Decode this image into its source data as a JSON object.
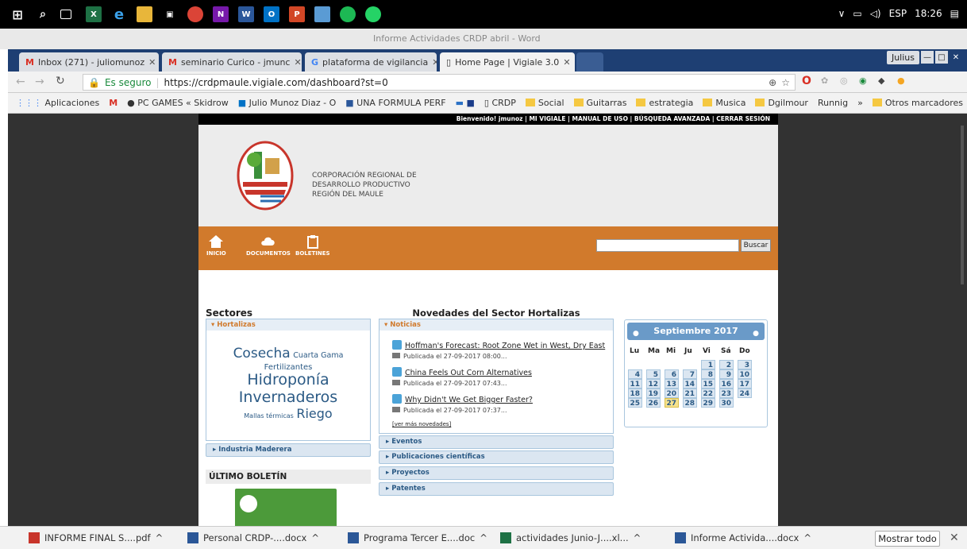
{
  "taskbar": {
    "tray": {
      "lang": "ESP",
      "time": "18:26"
    }
  },
  "desktop": {
    "window_title": "Informe Actividades CRDP abril - Word"
  },
  "chrome": {
    "tabs": [
      {
        "label": "Inbox (271) - juliomunoz"
      },
      {
        "label": "seminario Curico - jmunc"
      },
      {
        "label": "plataforma de vigilancia"
      },
      {
        "label": "Home Page | Vigiale 3.0"
      }
    ],
    "user": "Julius",
    "secure_label": "Es seguro",
    "url": "https://crdpmaule.vigiale.com/dashboard?st=0",
    "bookmarks": [
      "Aplicaciones",
      "PC GAMES « Skidrow",
      "Julio Munoz Diaz - O",
      "UNA FORMULA PERF",
      "CRDP",
      "Social",
      "Guitarras",
      "estrategia",
      "Musica",
      "Dgilmour",
      "Runnig",
      "»",
      "Otros marcadores"
    ]
  },
  "site": {
    "topbar": "Bienvenido! jmunoz  |  MI VIGIALE  |  MANUAL DE USO  |  BÚSQUEDA AVANZADA  |  CERRAR SESIÓN",
    "org": [
      "CORPORACIÓN REGIONAL DE",
      "DESARROLLO PRODUCTIVO",
      "REGIÓN DEL MAULE"
    ],
    "nav": [
      {
        "label": "INICIO"
      },
      {
        "label": "DOCUMENTOS"
      },
      {
        "label": "BOLETINES"
      }
    ],
    "search_button": "Buscar",
    "sectores_title": "Sectores",
    "sector_hortalizas": "Hortalizas",
    "tags": {
      "cosecha": "Cosecha",
      "cuarta": "Cuarta Gama",
      "fert": "Fertilizantes",
      "hidro": "Hidroponía",
      "inver": "Invernaderos",
      "mallas": "Mallas térmicas",
      "riego": "Riego"
    },
    "sector_maderera": "Industria Maderera",
    "ultimo_boletin": "ÚLTIMO BOLETÍN",
    "novedades_title": "Novedades del Sector Hortalizas",
    "noticias_label": "Noticias",
    "news": [
      {
        "title": "Hoffman's Forecast: Root Zone Wet in West, Dry East",
        "date": "Publicada el 27-09-2017 08:00..."
      },
      {
        "title": "China Feels Out Corn Alternatives",
        "date": "Publicada el 27-09-2017 07:43..."
      },
      {
        "title": "Why Didn't We Get Bigger Faster?",
        "date": "Publicada el 27-09-2017 07:37..."
      }
    ],
    "ver_mas": "[ver más novedades]",
    "sections": [
      "Eventos",
      "Publicaciones científicas",
      "Proyectos",
      "Patentes"
    ],
    "calendar": {
      "title": "Septiembre 2017",
      "dow": [
        "Lu",
        "Ma",
        "Mi",
        "Ju",
        "Vi",
        "Sá",
        "Do"
      ],
      "today": 27
    }
  },
  "downloads": {
    "items": [
      "INFORME FINAL S....pdf",
      "Personal CRDP-....docx",
      "Programa Tercer E....doc",
      "actividades Junio-J....xl...",
      "Informe Activida....docx"
    ],
    "show_all": "Mostrar todo"
  },
  "colors": {
    "accent": "#d17a2c",
    "panel_border": "#a9c6de",
    "calendar_header": "#6a9ac8",
    "today": "#f6e28c"
  }
}
